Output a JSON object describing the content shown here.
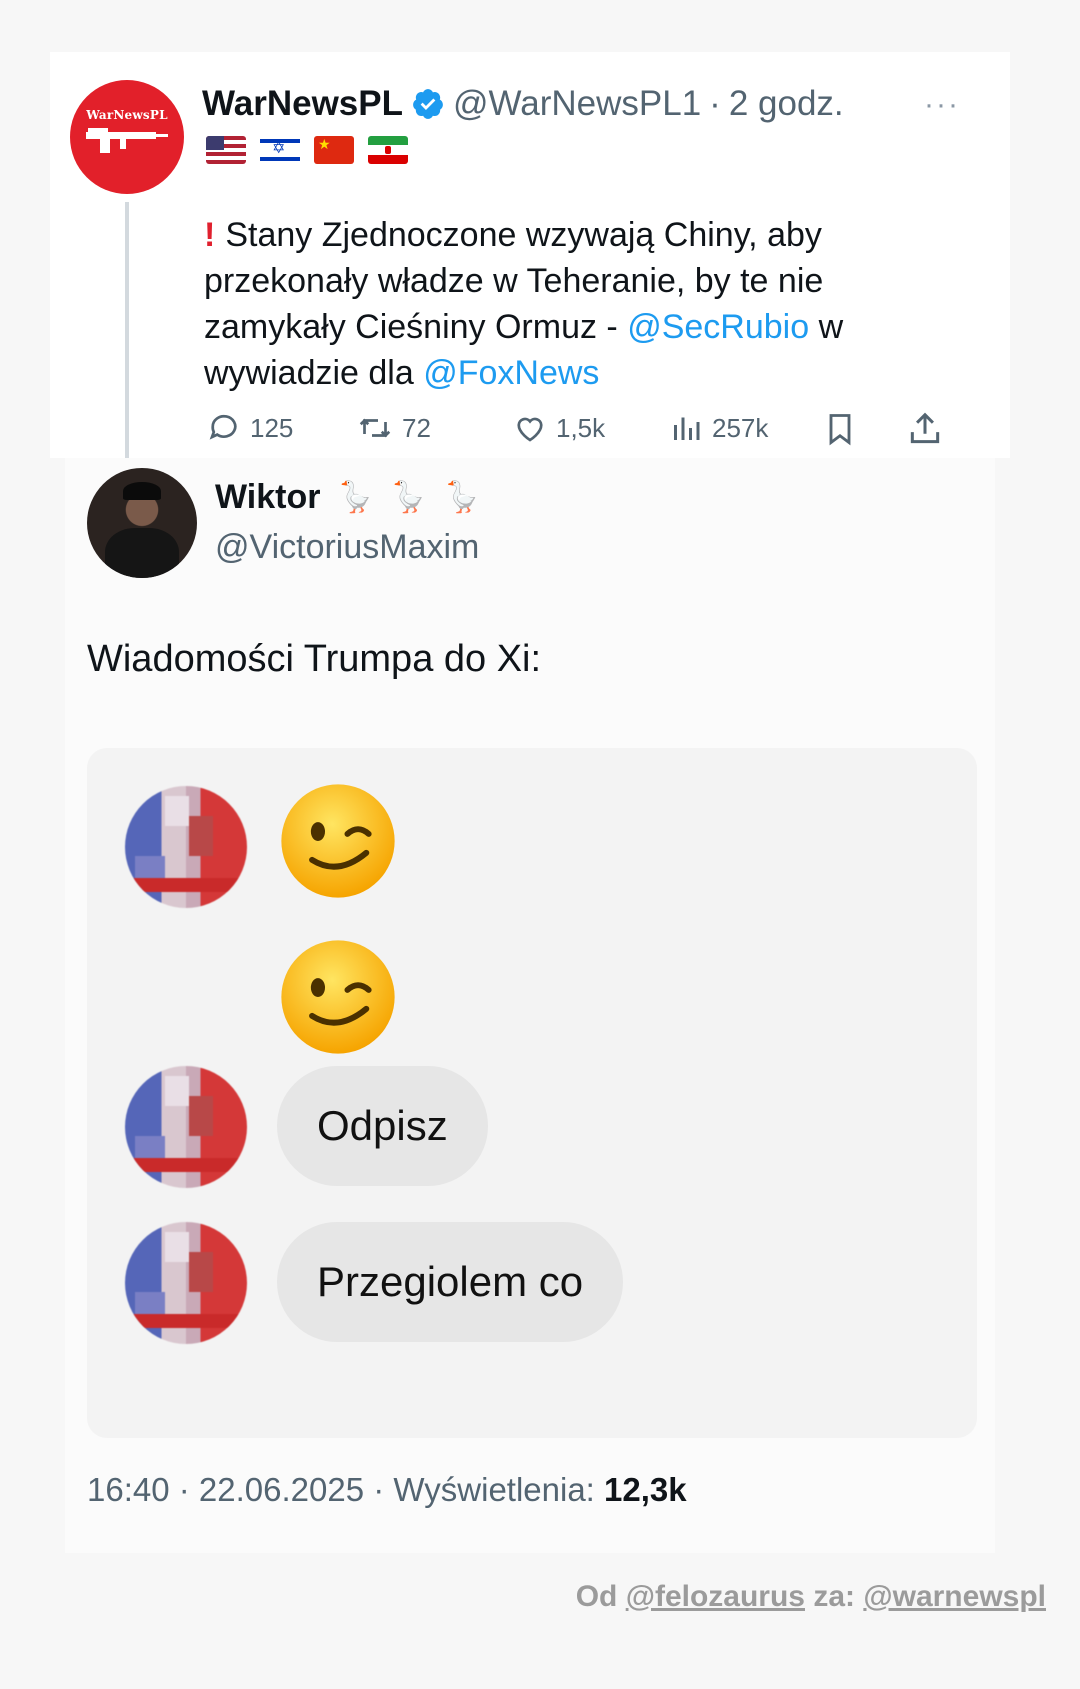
{
  "quoted_tweet": {
    "avatar_text": "WarNewsPL",
    "name": "WarNewsPL",
    "handle": "@WarNewsPL1",
    "separator": "·",
    "time": "2 godz.",
    "more": "···",
    "flags": [
      "us-flag",
      "israel-flag",
      "china-flag",
      "iran-flag"
    ],
    "text_before": "Stany Zjednoczone wzywają Chiny, aby przekonały władze w Teheranie, by te nie zamykały Cieśniny Ormuz - ",
    "mention1": "@SecRubio",
    "text_middle": " w wywiadzie dla ",
    "mention2": "@FoxNews",
    "exclamation": "!",
    "actions": {
      "replies": "125",
      "retweets": "72",
      "likes": "1,5k",
      "views": "257k"
    }
  },
  "tweet": {
    "name": "Wiktor",
    "name_emojis": [
      "🪿",
      "🪿",
      "🪿"
    ],
    "handle": "@VictoriusMaxim",
    "text": "Wiadomości Trumpa do Xi:",
    "chat": {
      "bubble1": "Odpisz",
      "bubble2": "Przegiolem co"
    },
    "footer": {
      "time": "16:40",
      "sep1": " · ",
      "date": "22.06.2025",
      "sep2": " · ",
      "views_label": "Wyświetlenia: ",
      "views_value": "12,3k"
    }
  },
  "credit": {
    "prefix": "Od ",
    "from": "@felozaurus",
    "middle": " za: ",
    "via": "@warnewspl"
  },
  "colors": {
    "link": "#1d9bf0",
    "muted": "#536471",
    "brand_red": "#e2202a"
  }
}
